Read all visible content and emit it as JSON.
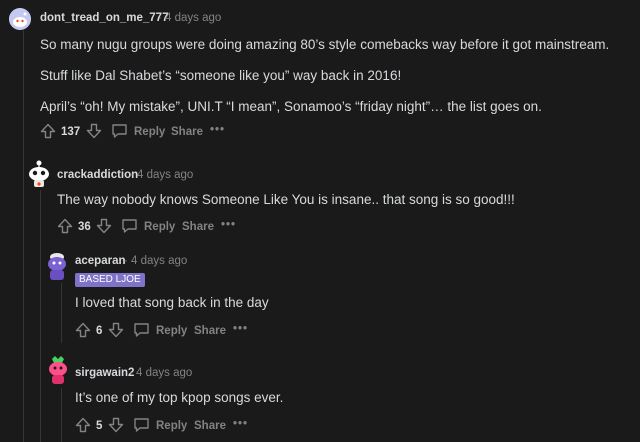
{
  "colors": {
    "background": "#1a1a1b",
    "text": "#d7dadc",
    "muted": "#818384",
    "thread_line": "#343536",
    "flair_bg": "#7e73c8"
  },
  "actions": {
    "reply": "Reply",
    "share": "Share",
    "more": "•••"
  },
  "comments": [
    {
      "username": "dont_tread_on_me_777",
      "time": "· 4 days ago",
      "paragraphs": [
        "So many nugu groups were doing amazing 80’s style comebacks way before it got mainstream.",
        "Stuff like Dal Shabet’s “someone like you” way back in 2016!",
        "April’s “oh! My mistake”, UNI.T “I mean”, Sonamoo’s “friday night”… the list goes on."
      ],
      "votes": "137"
    },
    {
      "username": "crackaddiction",
      "time": "· 4 days ago",
      "paragraphs": [
        "The way nobody knows Someone Like You is insane.. that song is so good!!!"
      ],
      "votes": "36"
    },
    {
      "username": "aceparan",
      "time": "· 4 days ago",
      "flair": "BASED LJOE",
      "paragraphs": [
        "I loved that song back in the day"
      ],
      "votes": "6"
    },
    {
      "username": "sirgawain2",
      "time": "· 4 days ago",
      "paragraphs": [
        "It’s one of my top kpop songs ever."
      ],
      "votes": "5"
    }
  ]
}
